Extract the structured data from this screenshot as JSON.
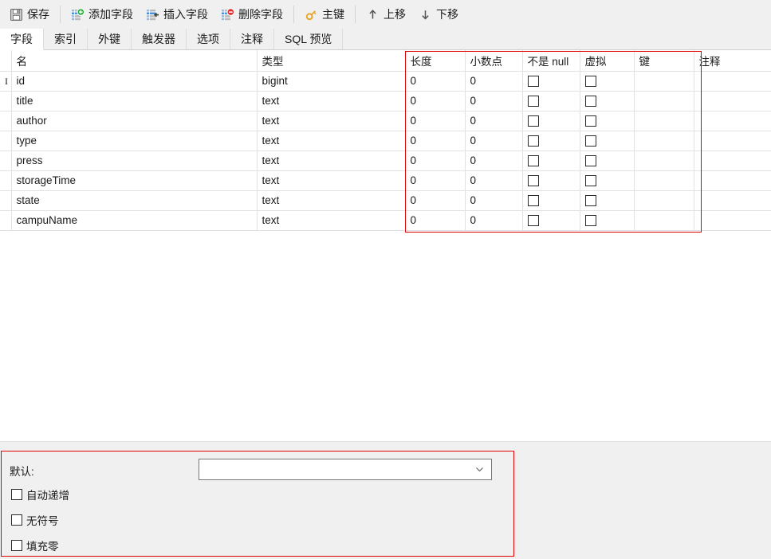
{
  "toolbar": {
    "items": [
      {
        "id": "save",
        "label": "保存",
        "icon": "save-disk-icon"
      },
      {
        "id": "sep1",
        "type": "separator"
      },
      {
        "id": "add-field",
        "label": "添加字段",
        "icon": "add-field-icon"
      },
      {
        "id": "insert-field",
        "label": "插入字段",
        "icon": "insert-field-icon"
      },
      {
        "id": "delete-field",
        "label": "删除字段",
        "icon": "delete-field-icon"
      },
      {
        "id": "sep2",
        "type": "separator"
      },
      {
        "id": "primary-key",
        "label": "主键",
        "icon": "key-icon"
      },
      {
        "id": "sep3",
        "type": "separator"
      },
      {
        "id": "move-up",
        "label": "上移",
        "icon": "arrow-up-icon"
      },
      {
        "id": "move-down",
        "label": "下移",
        "icon": "arrow-down-icon"
      }
    ]
  },
  "tabs": {
    "active": "字段",
    "items": [
      "字段",
      "索引",
      "外键",
      "触发器",
      "选项",
      "注释",
      "SQL 预览"
    ]
  },
  "grid": {
    "columns": [
      "名",
      "类型",
      "长度",
      "小数点",
      "不是 null",
      "虚拟",
      "键",
      "注释"
    ],
    "rows": [
      {
        "selected": true,
        "name": "id",
        "type": "bigint",
        "length": "0",
        "decimals": "0",
        "not_null": false,
        "virtual": false,
        "key": "",
        "comment": ""
      },
      {
        "selected": false,
        "name": "title",
        "type": "text",
        "length": "0",
        "decimals": "0",
        "not_null": false,
        "virtual": false,
        "key": "",
        "comment": ""
      },
      {
        "selected": false,
        "name": "author",
        "type": "text",
        "length": "0",
        "decimals": "0",
        "not_null": false,
        "virtual": false,
        "key": "",
        "comment": ""
      },
      {
        "selected": false,
        "name": "type",
        "type": "text",
        "length": "0",
        "decimals": "0",
        "not_null": false,
        "virtual": false,
        "key": "",
        "comment": ""
      },
      {
        "selected": false,
        "name": "press",
        "type": "text",
        "length": "0",
        "decimals": "0",
        "not_null": false,
        "virtual": false,
        "key": "",
        "comment": ""
      },
      {
        "selected": false,
        "name": "storageTime",
        "type": "text",
        "length": "0",
        "decimals": "0",
        "not_null": false,
        "virtual": false,
        "key": "",
        "comment": ""
      },
      {
        "selected": false,
        "name": "state",
        "type": "text",
        "length": "0",
        "decimals": "0",
        "not_null": false,
        "virtual": false,
        "key": "",
        "comment": ""
      },
      {
        "selected": false,
        "name": "campuName",
        "type": "text",
        "length": "0",
        "decimals": "0",
        "not_null": false,
        "virtual": false,
        "key": "",
        "comment": ""
      }
    ],
    "cursor_row_indicator": "I"
  },
  "properties": {
    "default_label": "默认:",
    "default_value": "",
    "default_placeholder": "",
    "checkboxes": [
      {
        "id": "auto-increment",
        "label": "自动递增",
        "checked": false
      },
      {
        "id": "unsigned",
        "label": "无符号",
        "checked": false
      },
      {
        "id": "zerofill",
        "label": "填充零",
        "checked": false
      }
    ]
  },
  "annotations": {
    "accent_color": "#e30000",
    "grid_highlight_columns": [
      "长度",
      "小数点",
      "不是 null",
      "虚拟",
      "键"
    ],
    "bottom_highlight": "属性面板"
  },
  "colors": {
    "toolbar_bg": "#f0f0f0",
    "grid_bg": "#ffffff",
    "grid_line": "#e2e2e2",
    "text": "#1a1a1a",
    "annotation_red": "#e30000"
  }
}
